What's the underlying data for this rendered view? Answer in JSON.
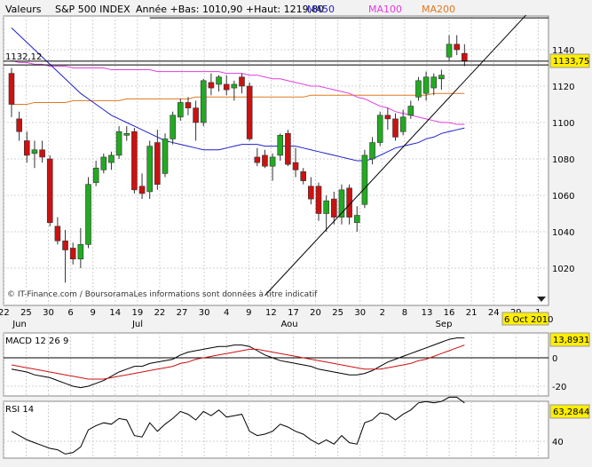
{
  "header": {
    "label": "Valeurs",
    "index_name": "S&P 500 INDEX",
    "range_text": "Année +Bas: 1010,90 +Haut: 1219,80",
    "legend": [
      {
        "name": "MA50",
        "color": "#1f1fcc"
      },
      {
        "name": "MA100",
        "color": "#e03ce0"
      },
      {
        "name": "MA200",
        "color": "#e07820"
      }
    ]
  },
  "price_panel": {
    "ref_label": "1132,12",
    "ref_value": 1132.12,
    "last_value_label": "1133,75",
    "last_value": 1133.75,
    "top_line_value": 1157.5,
    "y_ticks": [
      "1140",
      "1120",
      "1100",
      "1080",
      "1060",
      "1040",
      "1020"
    ],
    "x_ticks": [
      "22",
      "25",
      "30",
      "6",
      "9",
      "14",
      "19",
      "22",
      "27",
      "30",
      "4",
      "9",
      "12",
      "17",
      "20",
      "25",
      "30",
      "2",
      "8",
      "13",
      "16",
      "21",
      "24",
      "29",
      "1"
    ],
    "month_labels": [
      "Jul",
      "Aou",
      "Sep"
    ],
    "month_label_left": "Jun",
    "date_badge": "6 Oct 2010",
    "copyright": "© IT-Finance.com / BoursoramaLes informations sont données à titre indicatif"
  },
  "macd_panel": {
    "title": "MACD 12 26 9",
    "value_label": "13,8931",
    "y_ticks": [
      "0",
      "-20"
    ]
  },
  "rsi_panel": {
    "title": "RSI 14",
    "value_label": "63,2844",
    "y_ticks": [
      "40"
    ]
  },
  "colors": {
    "up": "#22aa22",
    "down": "#cc1111",
    "badge": "#ffee00",
    "panel_bg": "#ffffff",
    "grid": "#c8c8c8"
  },
  "chart_data": [
    {
      "type": "candlestick",
      "title": "S&P 500 INDEX",
      "ylim": [
        1005,
        1160
      ],
      "candles": [
        {
          "o": 1127,
          "h": 1130,
          "l": 1103,
          "c": 1110
        },
        {
          "o": 1102,
          "h": 1106,
          "l": 1090,
          "c": 1095
        },
        {
          "o": 1090,
          "h": 1095,
          "l": 1078,
          "c": 1082
        },
        {
          "o": 1083,
          "h": 1090,
          "l": 1075,
          "c": 1085
        },
        {
          "o": 1085,
          "h": 1090,
          "l": 1078,
          "c": 1081
        },
        {
          "o": 1080,
          "h": 1082,
          "l": 1043,
          "c": 1045
        },
        {
          "o": 1043,
          "h": 1048,
          "l": 1033,
          "c": 1035
        },
        {
          "o": 1035,
          "h": 1041,
          "l": 1012,
          "c": 1030
        },
        {
          "o": 1031,
          "h": 1034,
          "l": 1022,
          "c": 1025
        },
        {
          "o": 1025,
          "h": 1042,
          "l": 1020,
          "c": 1033
        },
        {
          "o": 1033,
          "h": 1070,
          "l": 1031,
          "c": 1066
        },
        {
          "o": 1067,
          "h": 1079,
          "l": 1065,
          "c": 1075
        },
        {
          "o": 1074,
          "h": 1083,
          "l": 1072,
          "c": 1081
        },
        {
          "o": 1078,
          "h": 1084,
          "l": 1074,
          "c": 1082
        },
        {
          "o": 1082,
          "h": 1098,
          "l": 1080,
          "c": 1095
        },
        {
          "o": 1093,
          "h": 1098,
          "l": 1090,
          "c": 1094
        },
        {
          "o": 1095,
          "h": 1097,
          "l": 1061,
          "c": 1063
        },
        {
          "o": 1065,
          "h": 1072,
          "l": 1058,
          "c": 1061
        },
        {
          "o": 1062,
          "h": 1090,
          "l": 1058,
          "c": 1087
        },
        {
          "o": 1089,
          "h": 1096,
          "l": 1063,
          "c": 1066
        },
        {
          "o": 1072,
          "h": 1094,
          "l": 1070,
          "c": 1091
        },
        {
          "o": 1091,
          "h": 1106,
          "l": 1088,
          "c": 1104
        },
        {
          "o": 1103,
          "h": 1113,
          "l": 1101,
          "c": 1111
        },
        {
          "o": 1111,
          "h": 1114,
          "l": 1104,
          "c": 1108
        },
        {
          "o": 1108,
          "h": 1112,
          "l": 1090,
          "c": 1100
        },
        {
          "o": 1100,
          "h": 1124,
          "l": 1098,
          "c": 1123
        },
        {
          "o": 1122,
          "h": 1127,
          "l": 1115,
          "c": 1119
        },
        {
          "o": 1121,
          "h": 1126,
          "l": 1117,
          "c": 1125
        },
        {
          "o": 1121,
          "h": 1126,
          "l": 1115,
          "c": 1118
        },
        {
          "o": 1119,
          "h": 1123,
          "l": 1112,
          "c": 1121
        },
        {
          "o": 1125,
          "h": 1127,
          "l": 1116,
          "c": 1120
        },
        {
          "o": 1120,
          "h": 1122,
          "l": 1090,
          "c": 1091
        },
        {
          "o": 1081,
          "h": 1086,
          "l": 1076,
          "c": 1078
        },
        {
          "o": 1082,
          "h": 1085,
          "l": 1075,
          "c": 1076
        },
        {
          "o": 1076,
          "h": 1083,
          "l": 1068,
          "c": 1081
        },
        {
          "o": 1082,
          "h": 1094,
          "l": 1079,
          "c": 1093
        },
        {
          "o": 1094,
          "h": 1096,
          "l": 1076,
          "c": 1077
        },
        {
          "o": 1078,
          "h": 1086,
          "l": 1070,
          "c": 1074
        },
        {
          "o": 1073,
          "h": 1075,
          "l": 1066,
          "c": 1068
        },
        {
          "o": 1065,
          "h": 1070,
          "l": 1055,
          "c": 1058
        },
        {
          "o": 1065,
          "h": 1067,
          "l": 1046,
          "c": 1050
        },
        {
          "o": 1050,
          "h": 1060,
          "l": 1040,
          "c": 1057
        },
        {
          "o": 1058,
          "h": 1062,
          "l": 1044,
          "c": 1048
        },
        {
          "o": 1048,
          "h": 1066,
          "l": 1044,
          "c": 1063
        },
        {
          "o": 1064,
          "h": 1066,
          "l": 1044,
          "c": 1048
        },
        {
          "o": 1045,
          "h": 1054,
          "l": 1040,
          "c": 1049
        },
        {
          "o": 1055,
          "h": 1085,
          "l": 1053,
          "c": 1082
        },
        {
          "o": 1080,
          "h": 1092,
          "l": 1077,
          "c": 1089
        },
        {
          "o": 1089,
          "h": 1106,
          "l": 1087,
          "c": 1104
        },
        {
          "o": 1104,
          "h": 1108,
          "l": 1096,
          "c": 1102
        },
        {
          "o": 1102,
          "h": 1105,
          "l": 1090,
          "c": 1092
        },
        {
          "o": 1095,
          "h": 1107,
          "l": 1093,
          "c": 1103
        },
        {
          "o": 1104,
          "h": 1112,
          "l": 1102,
          "c": 1109
        },
        {
          "o": 1114,
          "h": 1125,
          "l": 1112,
          "c": 1123
        },
        {
          "o": 1116,
          "h": 1128,
          "l": 1112,
          "c": 1125
        },
        {
          "o": 1119,
          "h": 1127,
          "l": 1115,
          "c": 1125
        },
        {
          "o": 1124,
          "h": 1129,
          "l": 1118,
          "c": 1126
        },
        {
          "o": 1136,
          "h": 1148,
          "l": 1134,
          "c": 1143
        },
        {
          "o": 1143,
          "h": 1148,
          "l": 1137,
          "c": 1140
        },
        {
          "o": 1138,
          "h": 1143,
          "l": 1131,
          "c": 1134
        }
      ],
      "ma50": [
        1152,
        1148,
        1144,
        1140,
        1136,
        1132,
        1128,
        1124,
        1120,
        1116,
        1113,
        1110,
        1107,
        1104,
        1102,
        1100,
        1098,
        1096,
        1094,
        1092,
        1090,
        1089,
        1088,
        1087,
        1086,
        1085,
        1085,
        1085,
        1086,
        1087,
        1088,
        1088,
        1088,
        1087,
        1087,
        1087,
        1087,
        1087,
        1086,
        1085,
        1084,
        1083,
        1082,
        1081,
        1080,
        1079,
        1079,
        1080,
        1082,
        1084,
        1086,
        1087,
        1088,
        1089,
        1091,
        1092,
        1094,
        1095,
        1096,
        1097
      ],
      "ma100": [
        1134,
        1133,
        1133,
        1132,
        1132,
        1131,
        1131,
        1131,
        1130,
        1130,
        1130,
        1130,
        1130,
        1129,
        1129,
        1129,
        1129,
        1129,
        1129,
        1128,
        1128,
        1128,
        1128,
        1128,
        1128,
        1128,
        1128,
        1128,
        1127,
        1127,
        1127,
        1126,
        1126,
        1125,
        1124,
        1124,
        1123,
        1122,
        1121,
        1120,
        1120,
        1119,
        1118,
        1117,
        1116,
        1114,
        1113,
        1111,
        1109,
        1108,
        1106,
        1105,
        1104,
        1103,
        1102,
        1101,
        1100,
        1100,
        1099,
        1099
      ],
      "ma200": [
        1110,
        1110,
        1110,
        1111,
        1111,
        1111,
        1111,
        1111,
        1112,
        1112,
        1112,
        1112,
        1112,
        1112,
        1112,
        1113,
        1113,
        1113,
        1113,
        1113,
        1113,
        1113,
        1113,
        1113,
        1114,
        1114,
        1114,
        1114,
        1114,
        1114,
        1114,
        1114,
        1114,
        1114,
        1114,
        1114,
        1114,
        1114,
        1114,
        1115,
        1115,
        1115,
        1115,
        1115,
        1115,
        1115,
        1115,
        1115,
        1115,
        1115,
        1115,
        1115,
        1115,
        1115,
        1115,
        1116,
        1116,
        1116,
        1116,
        1116
      ],
      "trendline": {
        "from_index": 33,
        "from_value": 1005,
        "to_index": 67,
        "to_value": 1159
      }
    },
    {
      "type": "line",
      "title": "MACD 12 26 9",
      "ylim": [
        -28,
        22
      ],
      "series": [
        {
          "color": "#000000",
          "values": [
            -8,
            -9,
            -10,
            -12,
            -13,
            -14,
            -16,
            -18,
            -20,
            -21,
            -20,
            -18,
            -16,
            -13,
            -10,
            -8,
            -6,
            -6,
            -4,
            -3,
            -2,
            -1,
            2,
            4,
            5,
            6,
            7,
            8,
            8,
            9,
            9,
            8,
            5,
            2,
            0,
            -2,
            -3,
            -4,
            -5,
            -6,
            -8,
            -9,
            -10,
            -11,
            -12,
            -12,
            -11,
            -9,
            -6,
            -3,
            -1,
            1,
            3,
            5,
            7,
            9,
            11,
            13,
            14,
            14
          ]
        },
        {
          "color": "#cc1111",
          "values": [
            -5,
            -6,
            -7,
            -8,
            -9,
            -10,
            -11,
            -12,
            -13,
            -14,
            -15,
            -15,
            -15,
            -14,
            -13,
            -12,
            -11,
            -10,
            -9,
            -8,
            -7,
            -6,
            -4,
            -3,
            -1,
            0,
            1,
            2,
            3,
            4,
            5,
            6,
            6,
            5,
            4,
            3,
            2,
            1,
            0,
            -1,
            -2,
            -3,
            -4,
            -5,
            -6,
            -7,
            -8,
            -8,
            -8,
            -7,
            -6,
            -5,
            -4,
            -2,
            -1,
            1,
            3,
            5,
            7,
            9
          ]
        }
      ]
    },
    {
      "type": "line",
      "title": "RSI 14",
      "ylim": [
        30,
        72
      ],
      "series": [
        {
          "color": "#000000",
          "values": [
            47,
            44,
            41,
            39,
            37,
            35,
            34,
            31,
            32,
            36,
            48,
            51,
            53,
            52,
            56,
            55,
            44,
            43,
            53,
            47,
            52,
            56,
            61,
            59,
            55,
            61,
            58,
            62,
            57,
            58,
            59,
            47,
            44,
            45,
            47,
            52,
            50,
            47,
            45,
            41,
            38,
            41,
            38,
            44,
            39,
            38,
            53,
            55,
            60,
            59,
            55,
            59,
            62,
            67,
            68,
            67,
            68,
            71,
            71,
            67
          ]
        }
      ]
    }
  ]
}
